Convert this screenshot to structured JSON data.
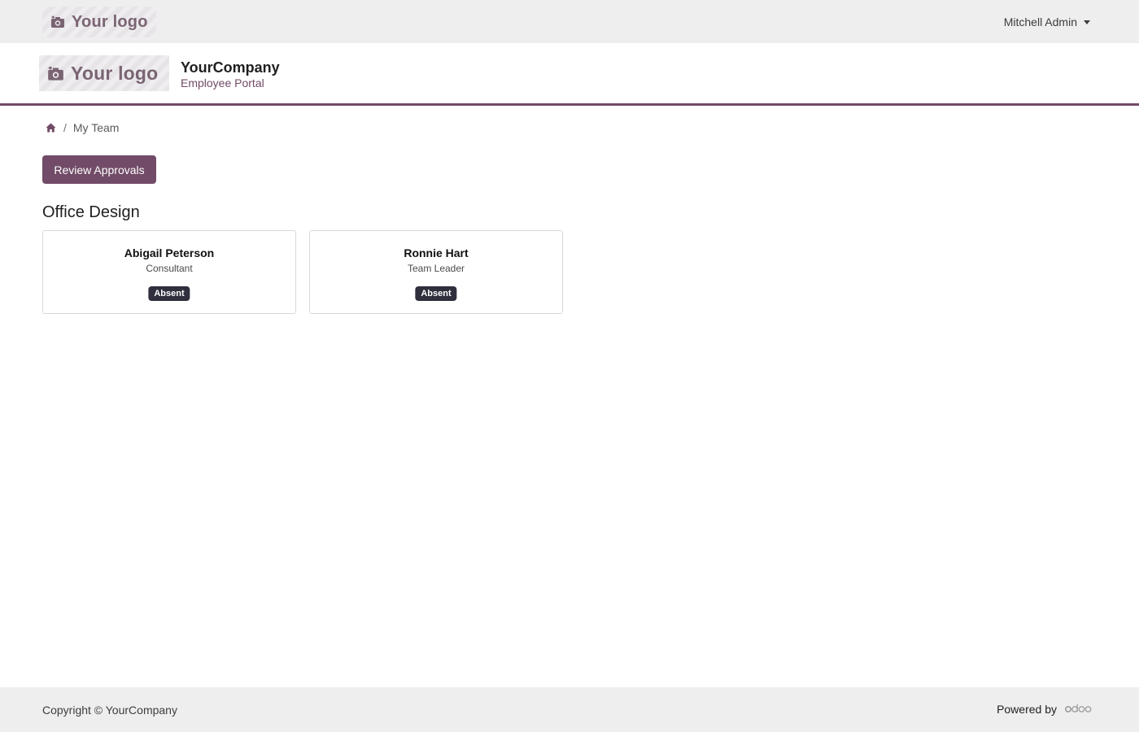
{
  "topbar": {
    "logo_text": "Your logo",
    "user_name": "Mitchell Admin"
  },
  "header": {
    "logo_text": "Your logo",
    "company_name": "YourCompany",
    "portal_name": "Employee Portal"
  },
  "breadcrumb": {
    "items": [
      {
        "icon": "home-icon"
      },
      {
        "label": "My Team"
      }
    ]
  },
  "actions": {
    "review_label": "Review Approvals"
  },
  "section": {
    "title": "Office Design"
  },
  "employees": [
    {
      "name": "Abigail Peterson",
      "job": "Consultant",
      "status": "Absent"
    },
    {
      "name": "Ronnie Hart",
      "job": "Team Leader",
      "status": "Absent"
    }
  ],
  "footer": {
    "copyright": "Copyright © YourCompany",
    "powered_by": "Powered by",
    "brand_logo": "odoo-logo"
  },
  "colors": {
    "brand": "#714b67",
    "topbar_bg": "#eeeeee",
    "badge_bg": "#2f2f3d"
  }
}
